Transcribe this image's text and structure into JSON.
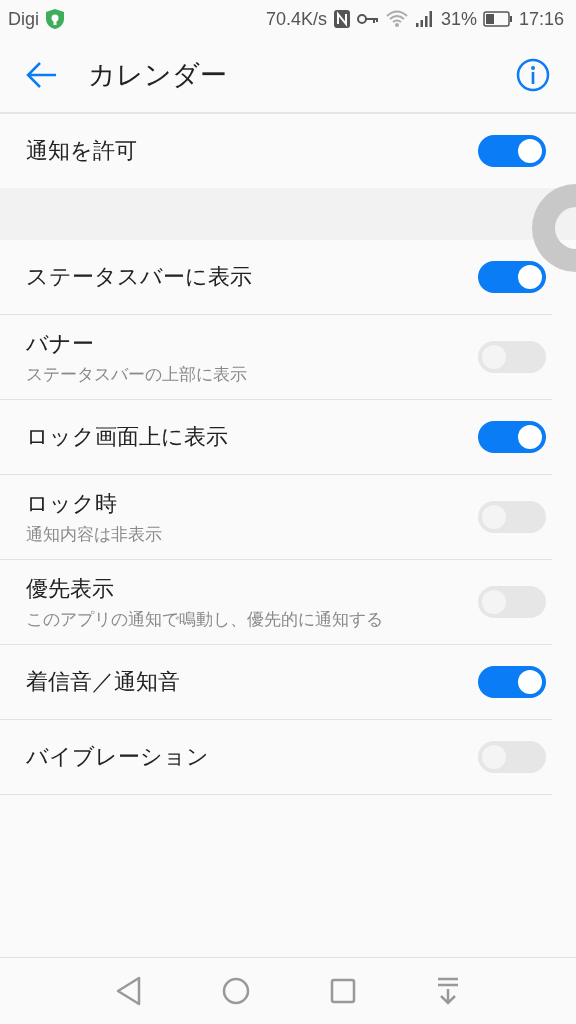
{
  "status_bar": {
    "carrier": "Digi",
    "speed": "70.4K/s",
    "battery": "31%",
    "time": "17:16"
  },
  "app_bar": {
    "title": "カレンダー"
  },
  "main_setting": {
    "label": "通知を許可",
    "on": true
  },
  "settings": [
    {
      "label": "ステータスバーに表示",
      "on": true
    },
    {
      "label": "バナー",
      "subtitle": "ステータスバーの上部に表示",
      "on": false
    },
    {
      "label": "ロック画面上に表示",
      "on": true
    },
    {
      "label": "ロック時",
      "subtitle": "通知内容は非表示",
      "on": false
    },
    {
      "label": "優先表示",
      "subtitle": "このアプリの通知で鳴動し、優先的に通知する",
      "on": false
    },
    {
      "label": "着信音／通知音",
      "on": true
    },
    {
      "label": "バイブレーション",
      "on": false
    }
  ]
}
